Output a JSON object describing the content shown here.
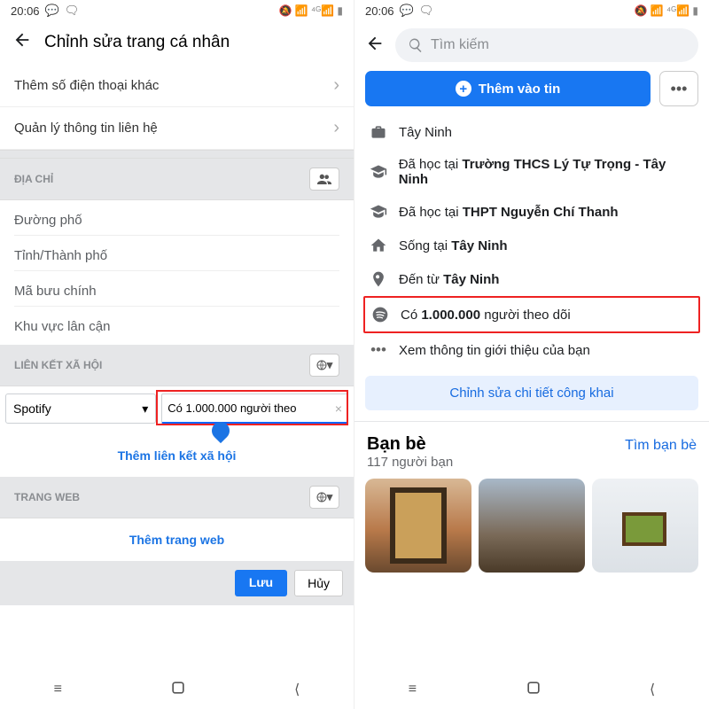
{
  "left": {
    "status": {
      "time": "20:06"
    },
    "header": {
      "title": "Chỉnh sửa trang cá nhân"
    },
    "rows": {
      "add_phone": "Thêm số điện thoại khác",
      "manage_contact": "Quản lý thông tin liên hệ"
    },
    "address": {
      "section_label": "ĐỊA CHỈ",
      "street": "Đường phố",
      "city": "Tỉnh/Thành phố",
      "postal": "Mã bưu chính",
      "area": "Khu vực lân cận"
    },
    "social": {
      "section_label": "LIÊN KẾT XÃ HỘI",
      "platform": "Spotify",
      "input": "Có 1.000.000 người theo",
      "add_label": "Thêm liên kết xã hội"
    },
    "web": {
      "section_label": "TRANG WEB",
      "add_label": "Thêm trang web"
    },
    "buttons": {
      "save": "Lưu",
      "cancel": "Hủy"
    }
  },
  "right": {
    "status": {
      "time": "20:06"
    },
    "search_placeholder": "Tìm kiếm",
    "story_button": "Thêm vào tin",
    "info": {
      "work_loc": "Tây Ninh",
      "edu1_prefix": "Đã học tại ",
      "edu1_bold": "Trường THCS Lý Tự Trọng - Tây Ninh",
      "edu2_prefix": "Đã học tại ",
      "edu2_bold": "THPT Nguyễn Chí Thanh",
      "lives_prefix": "Sống tại ",
      "lives_bold": "Tây Ninh",
      "from_prefix": "Đến từ ",
      "from_bold": "Tây Ninh",
      "followers_pre": "Có ",
      "followers_num": "1.000.000",
      "followers_post": " người theo dõi",
      "see_intro": "Xem thông tin giới thiệu của bạn"
    },
    "edit_public": "Chỉnh sửa chi tiết công khai",
    "friends": {
      "title": "Bạn bè",
      "find": "Tìm bạn bè",
      "count": "117 người bạn"
    }
  }
}
